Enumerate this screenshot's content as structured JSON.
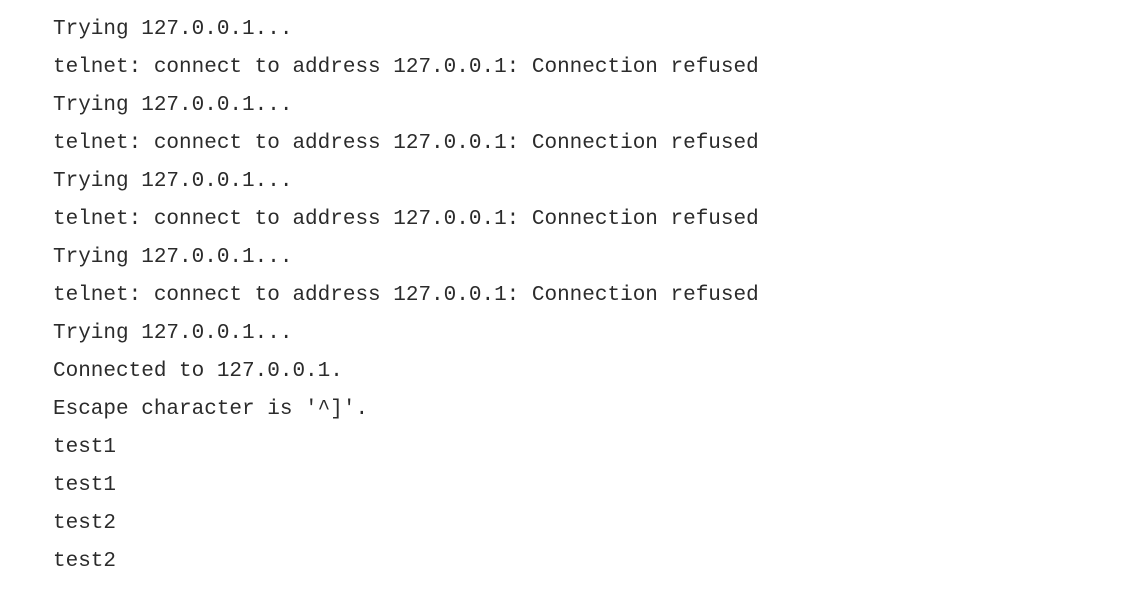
{
  "terminal": {
    "lines": [
      "Trying 127.0.0.1...",
      "telnet: connect to address 127.0.0.1: Connection refused",
      "Trying 127.0.0.1...",
      "telnet: connect to address 127.0.0.1: Connection refused",
      "Trying 127.0.0.1...",
      "telnet: connect to address 127.0.0.1: Connection refused",
      "Trying 127.0.0.1...",
      "telnet: connect to address 127.0.0.1: Connection refused",
      "Trying 127.0.0.1...",
      "Connected to 127.0.0.1.",
      "Escape character is '^]'.",
      "test1",
      "test1",
      "test2",
      "test2"
    ]
  },
  "colors": {
    "background": "#ffffff",
    "text": "#2b2b2b"
  }
}
